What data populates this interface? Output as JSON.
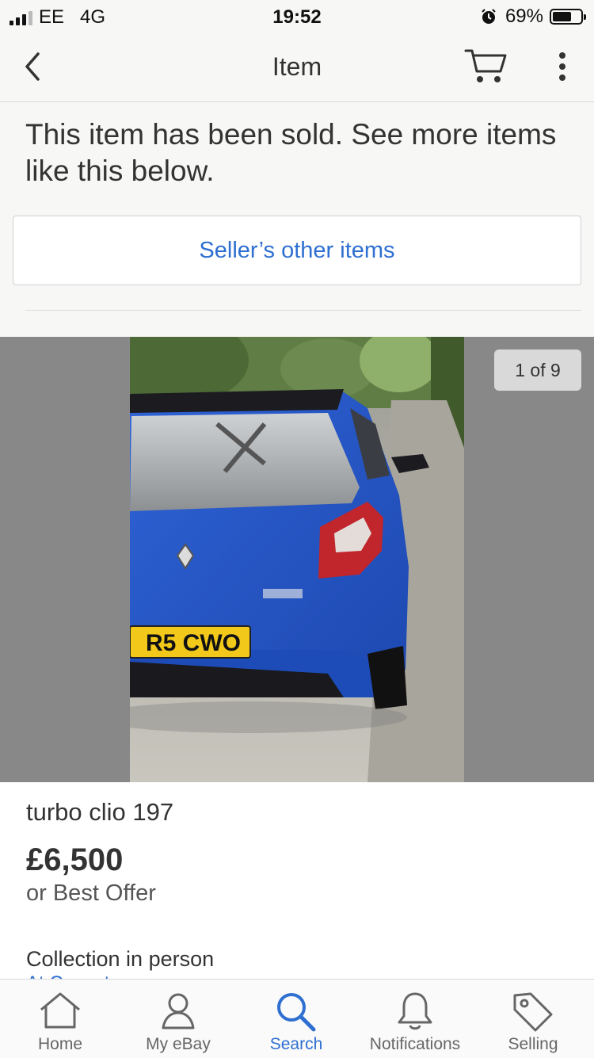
{
  "status_bar": {
    "carrier": "EE",
    "network": "4G",
    "time": "19:52",
    "battery": "69%",
    "battery_level": 0.69,
    "icons": [
      "signal-icon",
      "alarm-icon",
      "battery-icon"
    ]
  },
  "nav": {
    "title": "Item",
    "icons": [
      "back-chevron-icon",
      "cart-icon",
      "more-vertical-icon"
    ]
  },
  "sold_banner": {
    "message": "This item has been sold. See more items like this below.",
    "seller_button": "Seller’s other items"
  },
  "gallery": {
    "counter": "1 of 9",
    "plate": "R5 CWO"
  },
  "item": {
    "title": "turbo clio 197",
    "price": "£6,500",
    "offer": "or Best Offer",
    "delivery": "Collection in person",
    "location": "At Coventry"
  },
  "tabs": [
    {
      "label": "Home",
      "icon": "home-icon"
    },
    {
      "label": "My eBay",
      "icon": "person-icon"
    },
    {
      "label": "Search",
      "icon": "search-icon"
    },
    {
      "label": "Notifications",
      "icon": "bell-icon"
    },
    {
      "label": "Selling",
      "icon": "tag-icon"
    }
  ],
  "active_tab": "Search",
  "colors": {
    "accent": "#2e6fd1",
    "header_bg": "#f7f7f5",
    "gallery_bg": "#888888"
  }
}
